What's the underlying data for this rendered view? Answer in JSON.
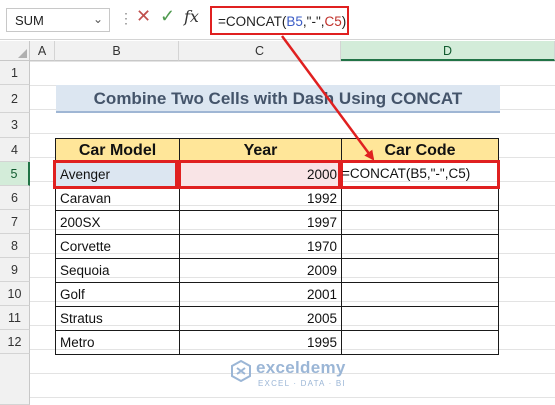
{
  "formula_bar": {
    "name_box": "SUM",
    "formula_prefix": "=CONCAT(",
    "ref1": "B5",
    "mid": ",\"-\",",
    "ref2": "C5",
    "suffix": ")"
  },
  "columns": [
    "A",
    "B",
    "C",
    "D"
  ],
  "rows": [
    "1",
    "2",
    "3",
    "4",
    "5",
    "6",
    "7",
    "8",
    "9",
    "10",
    "11",
    "12"
  ],
  "title": "Combine Two Cells with Dash Using CONCAT",
  "table": {
    "headers": [
      "Car Model",
      "Year",
      "Car Code"
    ],
    "rows": [
      {
        "model": "Avenger",
        "year": "2000",
        "code": "=CONCAT(B5,\"-\",C5)"
      },
      {
        "model": "Caravan",
        "year": "1992",
        "code": ""
      },
      {
        "model": "200SX",
        "year": "1997",
        "code": ""
      },
      {
        "model": "Corvette",
        "year": "1970",
        "code": ""
      },
      {
        "model": "Sequoia",
        "year": "2009",
        "code": ""
      },
      {
        "model": "Golf",
        "year": "2001",
        "code": ""
      },
      {
        "model": "Stratus",
        "year": "2005",
        "code": ""
      },
      {
        "model": "Metro",
        "year": "1995",
        "code": ""
      }
    ]
  },
  "watermark": {
    "name": "exceldemy",
    "tagline": "EXCEL · DATA · BI"
  }
}
